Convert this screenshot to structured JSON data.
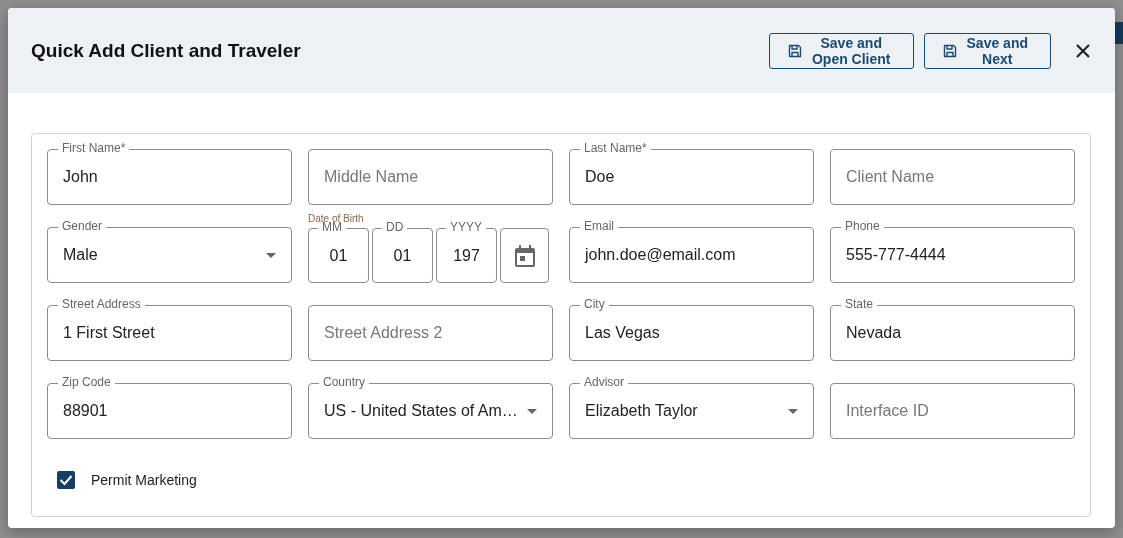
{
  "dialog": {
    "title": "Quick Add Client and Traveler",
    "buttons": [
      {
        "label": "Save and\nOpen Client"
      },
      {
        "label": "Save and\nNext"
      }
    ]
  },
  "fields": [
    {
      "kind": "text",
      "label": "First Name*",
      "value": "John"
    },
    {
      "kind": "text",
      "placeholder": "Middle Name"
    },
    {
      "kind": "text",
      "label": "Last Name*",
      "value": "Doe"
    },
    {
      "kind": "text",
      "placeholder": "Client Name"
    },
    {
      "kind": "select",
      "label": "Gender",
      "value": "Male"
    },
    {
      "kind": "date",
      "label": "Date of Birth",
      "parts": [
        {
          "label": "MM",
          "value": "01"
        },
        {
          "label": "DD",
          "value": "01"
        },
        {
          "label": "YYYY",
          "value": "197"
        }
      ]
    },
    {
      "kind": "text",
      "label": "Email",
      "value": "john.doe@email.com"
    },
    {
      "kind": "text",
      "label": "Phone",
      "value": "555-777-4444"
    },
    {
      "kind": "text",
      "label": "Street Address",
      "value": "1 First Street"
    },
    {
      "kind": "text",
      "placeholder": "Street Address 2"
    },
    {
      "kind": "text",
      "label": "City",
      "value": "Las Vegas"
    },
    {
      "kind": "text",
      "label": "State",
      "value": "Nevada"
    },
    {
      "kind": "text",
      "label": "Zip Code",
      "value": "88901"
    },
    {
      "kind": "select",
      "label": "Country",
      "value": "US - United States of Am…"
    },
    {
      "kind": "select",
      "label": "Advisor",
      "value": "Elizabeth Taylor"
    },
    {
      "kind": "text",
      "placeholder": "Interface ID"
    }
  ],
  "permit_marketing": {
    "label": "Permit Marketing",
    "checked": true
  }
}
